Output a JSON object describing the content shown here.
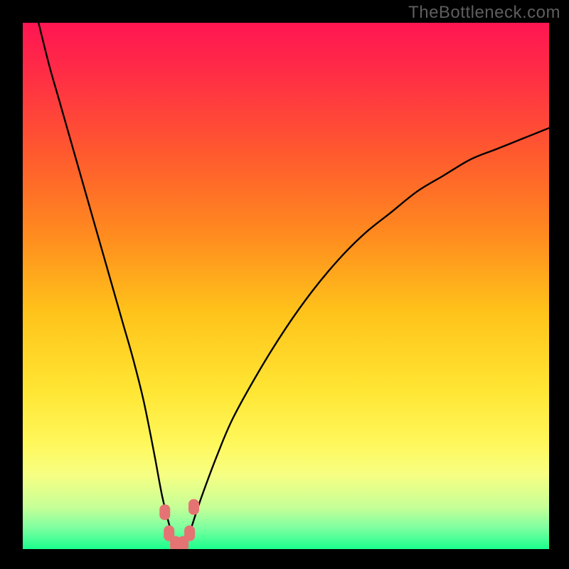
{
  "watermark": "TheBottleneck.com",
  "gradient": {
    "stops": [
      {
        "offset": 0.0,
        "color": "#ff1552"
      },
      {
        "offset": 0.1,
        "color": "#ff2e45"
      },
      {
        "offset": 0.25,
        "color": "#ff5a2e"
      },
      {
        "offset": 0.4,
        "color": "#ff8a1f"
      },
      {
        "offset": 0.55,
        "color": "#ffc31a"
      },
      {
        "offset": 0.7,
        "color": "#ffe634"
      },
      {
        "offset": 0.8,
        "color": "#fff85c"
      },
      {
        "offset": 0.86,
        "color": "#f6ff83"
      },
      {
        "offset": 0.92,
        "color": "#c7ff97"
      },
      {
        "offset": 0.96,
        "color": "#7dffa0"
      },
      {
        "offset": 1.0,
        "color": "#1aff8d"
      }
    ]
  },
  "chart_data": {
    "type": "line",
    "title": "",
    "xlabel": "",
    "ylabel": "",
    "xlim": [
      0,
      100
    ],
    "ylim": [
      0,
      100
    ],
    "series": [
      {
        "name": "bottleneck-curve",
        "x": [
          3,
          5,
          7,
          9,
          11,
          13,
          15,
          17,
          19,
          21,
          23,
          25,
          26.5,
          28,
          29,
          30,
          31,
          32,
          34,
          37,
          40,
          45,
          50,
          55,
          60,
          65,
          70,
          75,
          80,
          85,
          90,
          95,
          100
        ],
        "y": [
          100,
          92,
          85,
          78,
          71,
          64,
          57,
          50,
          43,
          36,
          28,
          18,
          10,
          4,
          1,
          0,
          1,
          4,
          10,
          18,
          25,
          34,
          42,
          49,
          55,
          60,
          64,
          68,
          71,
          74,
          76,
          78,
          80
        ]
      }
    ],
    "markers": {
      "name": "trough-markers",
      "color": "#e57373",
      "points": [
        {
          "x": 27.0,
          "y": 7
        },
        {
          "x": 27.8,
          "y": 3
        },
        {
          "x": 29.0,
          "y": 1
        },
        {
          "x": 30.5,
          "y": 1
        },
        {
          "x": 31.7,
          "y": 3
        },
        {
          "x": 32.5,
          "y": 8
        }
      ]
    }
  }
}
